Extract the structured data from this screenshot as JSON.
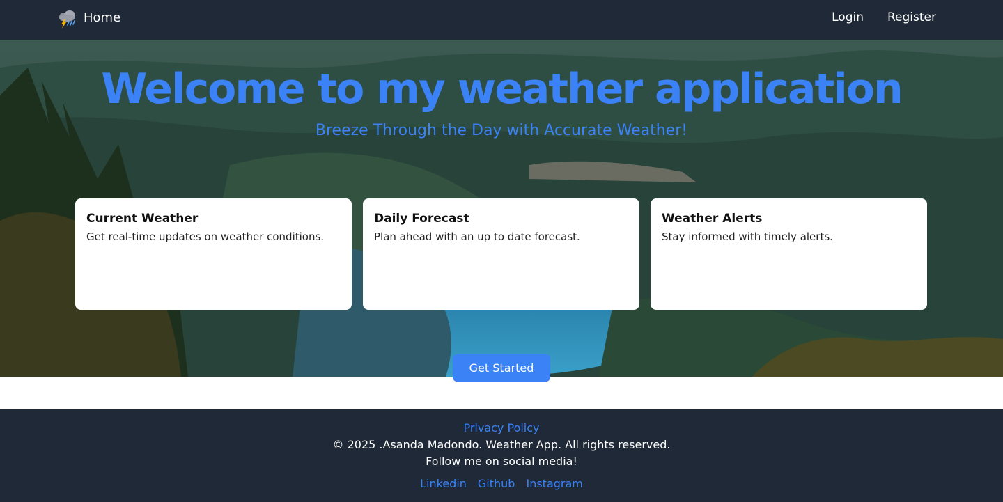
{
  "navbar": {
    "brand_icon": "storm-cloud-icon",
    "brand_label": "Home",
    "links": [
      {
        "label": "Login"
      },
      {
        "label": "Register"
      }
    ]
  },
  "hero": {
    "title": "Welcome to my weather application",
    "subtitle": "Breeze Through the Day with Accurate Weather!",
    "cards": [
      {
        "title": "Current Weather",
        "text": "Get real-time updates on weather conditions."
      },
      {
        "title": "Daily Forecast",
        "text": "Plan ahead with an up to date forecast."
      },
      {
        "title": "Weather Alerts",
        "text": "Stay informed with timely alerts."
      }
    ],
    "cta_label": "Get Started"
  },
  "footer": {
    "privacy_label": "Privacy Policy",
    "copyright": "© 2025 .Asanda Madondo. Weather App. All rights reserved.",
    "follow_text": "Follow me on social media!",
    "socials": [
      {
        "label": "Linkedin"
      },
      {
        "label": "Github"
      },
      {
        "label": "Instagram"
      }
    ]
  },
  "colors": {
    "navbar_bg": "#1f2937",
    "accent": "#3b82f6",
    "card_bg": "#ffffff"
  }
}
